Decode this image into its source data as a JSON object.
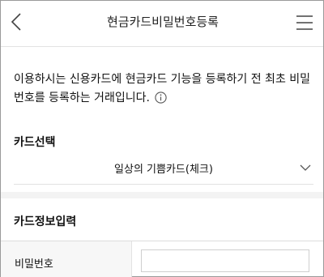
{
  "header": {
    "title": "현금카드비밀번호등록",
    "back_icon": "chevron-left-icon",
    "menu_icon": "hamburger-menu-icon"
  },
  "description": {
    "text": "이용하시는 신용카드에 현금카드 기능을 등록하기 전 최초 비밀번호를 등록하는 거래입니다.",
    "info_icon": "info-circle-icon"
  },
  "card_select": {
    "label": "카드선택",
    "selected_value": "일상의 기쁨카드(체크)",
    "dropdown_icon": "chevron-down-icon"
  },
  "card_info": {
    "label": "카드정보입력",
    "password_label": "비밀번호",
    "password_value": ""
  }
}
